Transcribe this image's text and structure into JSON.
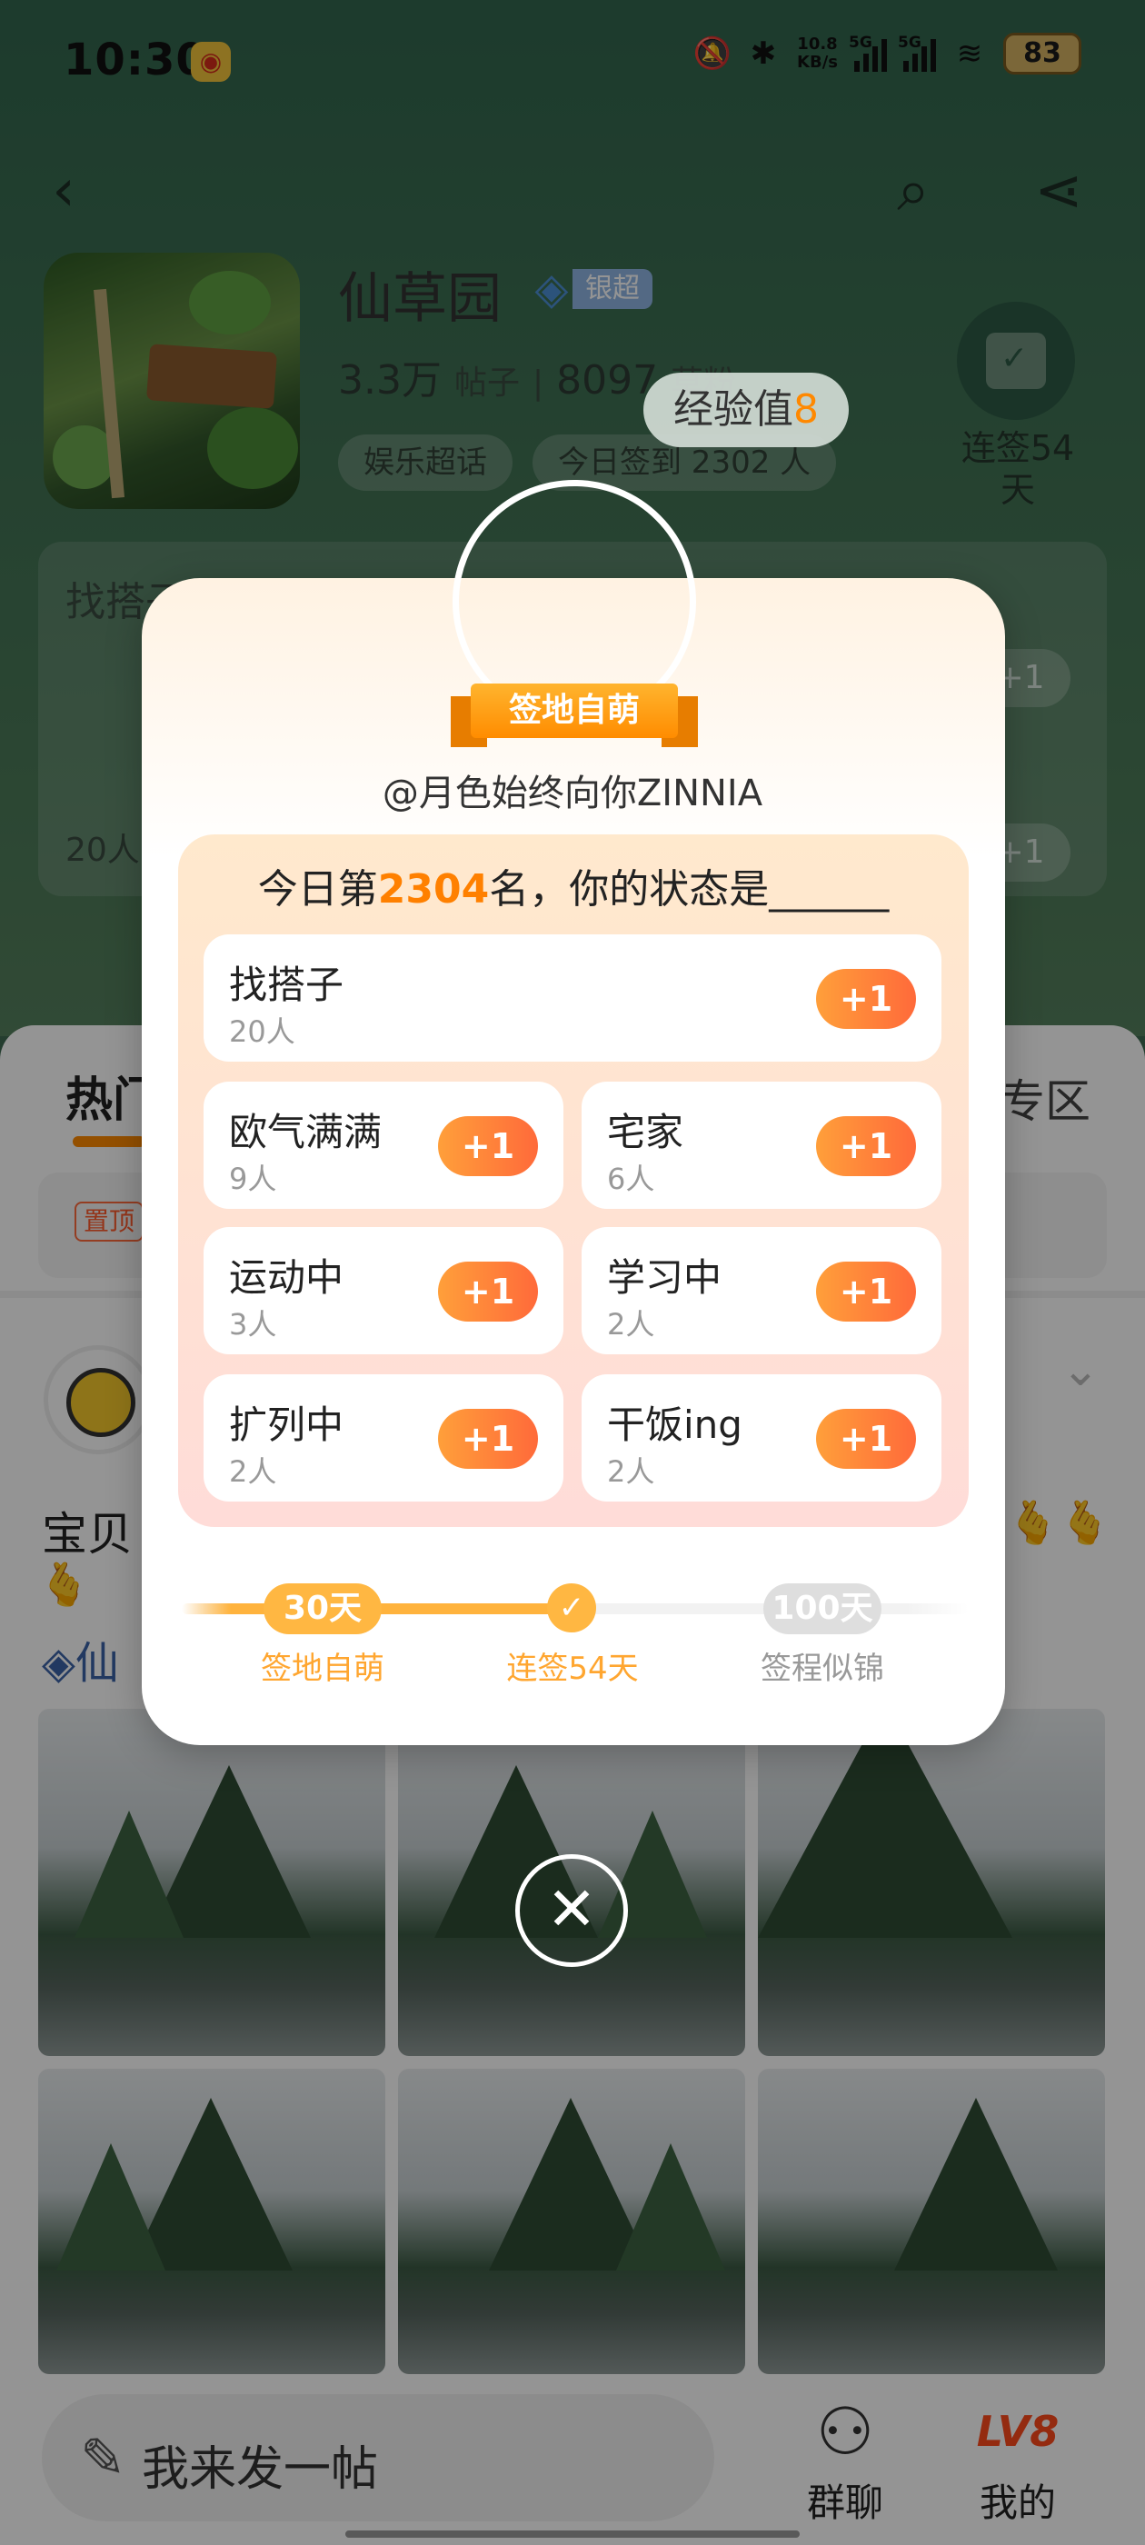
{
  "status_bar": {
    "time": "10:30",
    "speed_top": "10.8",
    "speed_bottom": "KB/s",
    "sig1_label": "5G",
    "sig2_label": "5G",
    "battery": "83"
  },
  "header": {
    "title": "仙草园",
    "badge": "银超",
    "posts_count": "3.3万",
    "posts_label": "帖子",
    "fans_count": "8097",
    "fans_label": "草粉",
    "chips": [
      "娱乐超话",
      "今日签到 2302 人"
    ],
    "sign_label": "连签54天",
    "exp_label": "经验值",
    "exp_value": "8"
  },
  "bg_cards": {
    "row1": "找搭子",
    "row2": "20人",
    "plus": "+1"
  },
  "feed": {
    "tab_hot": "热门",
    "tab_zone": "专区",
    "pin": "置顶",
    "post_text": "宝贝",
    "topic": "仙"
  },
  "modal": {
    "ribbon": "签地自萌",
    "handle": "@月色始终向你ZINNIA",
    "rank_prefix": "今日第",
    "rank_value": "2304",
    "rank_suffix": "名，你的状态是______",
    "options": [
      {
        "name": "找搭子",
        "count": "20人",
        "plus": "+1"
      },
      {
        "name": "欧气满满",
        "count": "9人",
        "plus": "+1"
      },
      {
        "name": "宅家",
        "count": "6人",
        "plus": "+1"
      },
      {
        "name": "运动中",
        "count": "3人",
        "plus": "+1"
      },
      {
        "name": "学习中",
        "count": "2人",
        "plus": "+1"
      },
      {
        "name": "扩列中",
        "count": "2人",
        "plus": "+1"
      },
      {
        "name": "干饭ing",
        "count": "2人",
        "plus": "+1"
      }
    ],
    "progress_fraction": 0.52,
    "milestones": [
      {
        "badge": "30天",
        "label": "签地自萌"
      },
      {
        "badge": "✓",
        "label": "连签54天"
      },
      {
        "badge": "100天",
        "label": "签程似锦"
      }
    ]
  },
  "bottom": {
    "compose_placeholder": "我来发一帖",
    "chat_label": "群聊",
    "me_label": "我的",
    "me_level": "LV8"
  },
  "colors": {
    "accent": "#ff8800",
    "plus_gradient_start": "#ff9f3a",
    "plus_gradient_end": "#ff6a3a",
    "milestone_done": "#ffb742"
  }
}
